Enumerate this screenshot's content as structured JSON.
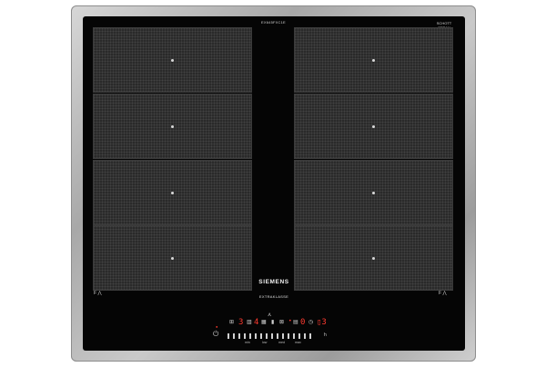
{
  "appliance": {
    "brand": "SIEMENS",
    "series": "EXTRAKLASSE",
    "glass_maker": [
      "SCHOTT",
      "CERAN"
    ],
    "serial_top": "EX645FXC1E",
    "surface_color": "#050505",
    "frame_color": "#b5b5b5"
  },
  "zones": [
    {
      "id": "left-1"
    },
    {
      "id": "left-2"
    },
    {
      "id": "left-3"
    },
    {
      "id": "left-4"
    },
    {
      "id": "right-1"
    },
    {
      "id": "right-2"
    },
    {
      "id": "right-3"
    },
    {
      "id": "right-4"
    }
  ],
  "controls": {
    "left_flex_label": "F",
    "right_flex_label": "F",
    "power_icon": "power-icon",
    "display_left": "3",
    "display_mid": "4",
    "display_a": "0",
    "display_timer": "3",
    "timer_suffix": "h",
    "accent_red": "#ff3b30",
    "slider_labels": [
      "min",
      "low",
      "med",
      "max"
    ]
  }
}
